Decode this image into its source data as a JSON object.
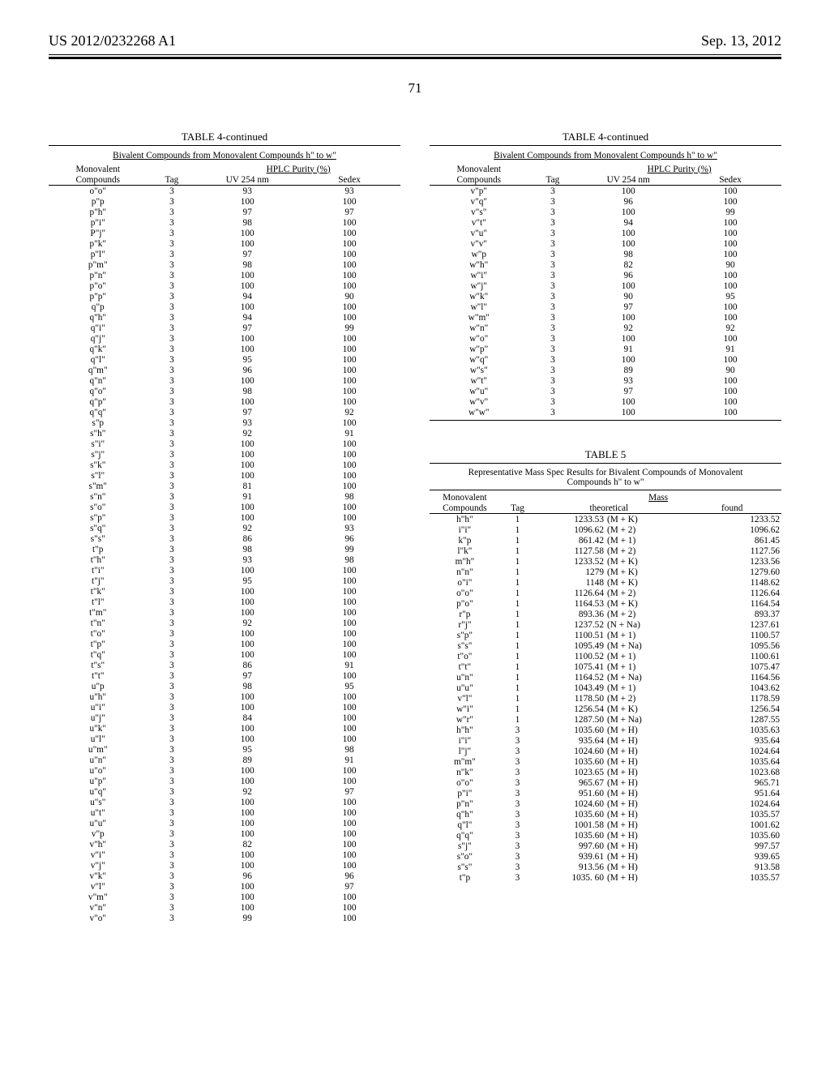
{
  "header": {
    "pub_no": "US 2012/0232268 A1",
    "date": "Sep. 13, 2012",
    "page_no": "71"
  },
  "table4": {
    "title": "TABLE 4-continued",
    "subtitle": "Bivalent Compounds from Monovalent Compounds h\" to w\"",
    "head": {
      "mono": "Monovalent",
      "compounds": "Compounds",
      "tag": "Tag",
      "hplc": "HPLC Purity (%)",
      "uv": "UV 254 nm",
      "sedex": "Sedex"
    },
    "left_rows": [
      [
        "o\"o\"",
        "3",
        "93",
        "93"
      ],
      [
        "p\"p",
        "3",
        "100",
        "100"
      ],
      [
        "p\"h\"",
        "3",
        "97",
        "97"
      ],
      [
        "p\"i\"",
        "3",
        "98",
        "100"
      ],
      [
        "P\"j\"",
        "3",
        "100",
        "100"
      ],
      [
        "p\"k\"",
        "3",
        "100",
        "100"
      ],
      [
        "p\"l\"",
        "3",
        "97",
        "100"
      ],
      [
        "p\"m\"",
        "3",
        "98",
        "100"
      ],
      [
        "p\"n\"",
        "3",
        "100",
        "100"
      ],
      [
        "p\"o\"",
        "3",
        "100",
        "100"
      ],
      [
        "p\"p\"",
        "3",
        "94",
        "90"
      ],
      [
        "q\"p",
        "3",
        "100",
        "100"
      ],
      [
        "q\"h\"",
        "3",
        "94",
        "100"
      ],
      [
        "q\"i\"",
        "3",
        "97",
        "99"
      ],
      [
        "q\"j\"",
        "3",
        "100",
        "100"
      ],
      [
        "q\"k\"",
        "3",
        "100",
        "100"
      ],
      [
        "q\"l\"",
        "3",
        "95",
        "100"
      ],
      [
        "q\"m\"",
        "3",
        "96",
        "100"
      ],
      [
        "q\"n\"",
        "3",
        "100",
        "100"
      ],
      [
        "q\"o\"",
        "3",
        "98",
        "100"
      ],
      [
        "q\"p\"",
        "3",
        "100",
        "100"
      ],
      [
        "q\"q\"",
        "3",
        "97",
        "92"
      ],
      [
        "s\"p",
        "3",
        "93",
        "100"
      ],
      [
        "s\"h\"",
        "3",
        "92",
        "91"
      ],
      [
        "s\"i\"",
        "3",
        "100",
        "100"
      ],
      [
        "s\"j\"",
        "3",
        "100",
        "100"
      ],
      [
        "s\"k\"",
        "3",
        "100",
        "100"
      ],
      [
        "s\"l\"",
        "3",
        "100",
        "100"
      ],
      [
        "s\"m\"",
        "3",
        "81",
        "100"
      ],
      [
        "s\"n\"",
        "3",
        "91",
        "98"
      ],
      [
        "s\"o\"",
        "3",
        "100",
        "100"
      ],
      [
        "s\"p\"",
        "3",
        "100",
        "100"
      ],
      [
        "s\"q\"",
        "3",
        "92",
        "93"
      ],
      [
        "s\"s\"",
        "3",
        "86",
        "96"
      ],
      [
        "t\"p",
        "3",
        "98",
        "99"
      ],
      [
        "t\"h\"",
        "3",
        "93",
        "98"
      ],
      [
        "t\"i\"",
        "3",
        "100",
        "100"
      ],
      [
        "t\"j\"",
        "3",
        "95",
        "100"
      ],
      [
        "t\"k\"",
        "3",
        "100",
        "100"
      ],
      [
        "t\"l\"",
        "3",
        "100",
        "100"
      ],
      [
        "t\"m\"",
        "3",
        "100",
        "100"
      ],
      [
        "t\"n\"",
        "3",
        "92",
        "100"
      ],
      [
        "t\"o\"",
        "3",
        "100",
        "100"
      ],
      [
        "t\"p\"",
        "3",
        "100",
        "100"
      ],
      [
        "t\"q\"",
        "3",
        "100",
        "100"
      ],
      [
        "t\"s\"",
        "3",
        "86",
        "91"
      ],
      [
        "t\"t\"",
        "3",
        "97",
        "100"
      ],
      [
        "u\"p",
        "3",
        "98",
        "95"
      ],
      [
        "u\"h\"",
        "3",
        "100",
        "100"
      ],
      [
        "u\"i\"",
        "3",
        "100",
        "100"
      ],
      [
        "u\"j\"",
        "3",
        "84",
        "100"
      ],
      [
        "u\"k\"",
        "3",
        "100",
        "100"
      ],
      [
        "u\"l\"",
        "3",
        "100",
        "100"
      ],
      [
        "u\"m\"",
        "3",
        "95",
        "98"
      ],
      [
        "u\"n\"",
        "3",
        "89",
        "91"
      ],
      [
        "u\"o\"",
        "3",
        "100",
        "100"
      ],
      [
        "u\"p\"",
        "3",
        "100",
        "100"
      ],
      [
        "u\"q\"",
        "3",
        "92",
        "97"
      ],
      [
        "u\"s\"",
        "3",
        "100",
        "100"
      ],
      [
        "u\"t\"",
        "3",
        "100",
        "100"
      ],
      [
        "u\"u\"",
        "3",
        "100",
        "100"
      ],
      [
        "v\"p",
        "3",
        "100",
        "100"
      ],
      [
        "v\"h\"",
        "3",
        "82",
        "100"
      ],
      [
        "v\"i\"",
        "3",
        "100",
        "100"
      ],
      [
        "v\"j\"",
        "3",
        "100",
        "100"
      ],
      [
        "v\"k\"",
        "3",
        "96",
        "96"
      ],
      [
        "v\"l\"",
        "3",
        "100",
        "97"
      ],
      [
        "v\"m\"",
        "3",
        "100",
        "100"
      ],
      [
        "v\"n\"",
        "3",
        "100",
        "100"
      ],
      [
        "v\"o\"",
        "3",
        "99",
        "100"
      ]
    ],
    "right_rows": [
      [
        "v\"p\"",
        "3",
        "100",
        "100"
      ],
      [
        "v\"q\"",
        "3",
        "96",
        "100"
      ],
      [
        "v\"s\"",
        "3",
        "100",
        "99"
      ],
      [
        "v\"t\"",
        "3",
        "94",
        "100"
      ],
      [
        "v\"u\"",
        "3",
        "100",
        "100"
      ],
      [
        "v\"v\"",
        "3",
        "100",
        "100"
      ],
      [
        "w\"p",
        "3",
        "98",
        "100"
      ],
      [
        "w\"h\"",
        "3",
        "82",
        "90"
      ],
      [
        "w\"i\"",
        "3",
        "96",
        "100"
      ],
      [
        "w\"j\"",
        "3",
        "100",
        "100"
      ],
      [
        "w\"k\"",
        "3",
        "90",
        "95"
      ],
      [
        "w\"l\"",
        "3",
        "97",
        "100"
      ],
      [
        "w\"m\"",
        "3",
        "100",
        "100"
      ],
      [
        "w\"n\"",
        "3",
        "92",
        "92"
      ],
      [
        "w\"o\"",
        "3",
        "100",
        "100"
      ],
      [
        "w\"p\"",
        "3",
        "91",
        "91"
      ],
      [
        "w\"q\"",
        "3",
        "100",
        "100"
      ],
      [
        "w\"s\"",
        "3",
        "89",
        "90"
      ],
      [
        "w\"t\"",
        "3",
        "93",
        "100"
      ],
      [
        "w\"u\"",
        "3",
        "97",
        "100"
      ],
      [
        "w\"v\"",
        "3",
        "100",
        "100"
      ],
      [
        "w\"w\"",
        "3",
        "100",
        "100"
      ]
    ]
  },
  "table5": {
    "title": "TABLE 5",
    "subtitle": "Representative Mass Spec Results for Bivalent Compounds of Monovalent Compounds h\" to w\"",
    "head": {
      "mono": "Monovalent",
      "compounds": "Compounds",
      "tag": "Tag",
      "mass": "Mass",
      "theoretical": "theoretical",
      "found": "found"
    },
    "rows": [
      [
        "h\"h\"",
        "1",
        "1233.53",
        "(M + K)",
        "1233.52"
      ],
      [
        "i\"i\"",
        "1",
        "1096.62",
        "(M + 2)",
        "1096.62"
      ],
      [
        "k\"p",
        "1",
        "861.42",
        "(M + 1)",
        "861.45"
      ],
      [
        "l\"k\"",
        "1",
        "1127.58",
        "(M + 2)",
        "1127.56"
      ],
      [
        "m\"h\"",
        "1",
        "1233.52",
        "(M + K)",
        "1233.56"
      ],
      [
        "n\"n\"",
        "1",
        "1279",
        "(M + K)",
        "1279.60"
      ],
      [
        "o\"i\"",
        "1",
        "1148",
        "(M + K)",
        "1148.62"
      ],
      [
        "o\"o\"",
        "1",
        "1126.64",
        "(M + 2)",
        "1126.64"
      ],
      [
        "p\"o\"",
        "1",
        "1164.53",
        "(M + K)",
        "1164.54"
      ],
      [
        "r\"p",
        "1",
        "893.36",
        "(M + 2)",
        "893.37"
      ],
      [
        "r\"j\"",
        "1",
        "1237.52",
        "(N + Na)",
        "1237.61"
      ],
      [
        "s\"p\"",
        "1",
        "1100.51",
        "(M + 1)",
        "1100.57"
      ],
      [
        "s\"s\"",
        "1",
        "1095.49",
        "(M + Na)",
        "1095.56"
      ],
      [
        "t\"o\"",
        "1",
        "1100.52",
        "(M + 1)",
        "1100.61"
      ],
      [
        "t\"t\"",
        "1",
        "1075.41",
        "(M + 1)",
        "1075.47"
      ],
      [
        "u\"n\"",
        "1",
        "1164.52",
        "(M + Na)",
        "1164.56"
      ],
      [
        "u\"u\"",
        "1",
        "1043.49",
        "(M + 1)",
        "1043.62"
      ],
      [
        "v\"l\"",
        "1",
        "1178.50",
        "(M + 2)",
        "1178.59"
      ],
      [
        "w\"i\"",
        "1",
        "1256.54",
        "(M + K)",
        "1256.54"
      ],
      [
        "w\"r\"",
        "1",
        "1287.50",
        "(M + Na)",
        "1287.55"
      ],
      [
        "h\"h\"",
        "3",
        "1035.60",
        "(M + H)",
        "1035.63"
      ],
      [
        "i\"i\"",
        "3",
        "935.64",
        "(M + H)",
        "935.64"
      ],
      [
        "l\"j\"",
        "3",
        "1024.60",
        "(M + H)",
        "1024.64"
      ],
      [
        "m\"m\"",
        "3",
        "1035.60",
        "(M + H)",
        "1035.64"
      ],
      [
        "n\"k\"",
        "3",
        "1023.65",
        "(M + H)",
        "1023.68"
      ],
      [
        "o\"o\"",
        "3",
        "965.67",
        "(M + H)",
        "965.71"
      ],
      [
        "p\"i\"",
        "3",
        "951.60",
        "(M + H)",
        "951.64"
      ],
      [
        "p\"n\"",
        "3",
        "1024.60",
        "(M + H)",
        "1024.64"
      ],
      [
        "q\"h\"",
        "3",
        "1035.60",
        "(M + H)",
        "1035.57"
      ],
      [
        "q\"l\"",
        "3",
        "1001.58",
        "(M + H)",
        "1001.62"
      ],
      [
        "q\"q\"",
        "3",
        "1035.60",
        "(M + H)",
        "1035.60"
      ],
      [
        "s\"j\"",
        "3",
        "997.60",
        "(M + H)",
        "997.57"
      ],
      [
        "s\"o\"",
        "3",
        "939.61",
        "(M + H)",
        "939.65"
      ],
      [
        "s\"s\"",
        "3",
        "913.56",
        "(M + H)",
        "913.58"
      ],
      [
        "t\"p",
        "3",
        "1035. 60",
        "(M + H)",
        "1035.57"
      ]
    ]
  }
}
